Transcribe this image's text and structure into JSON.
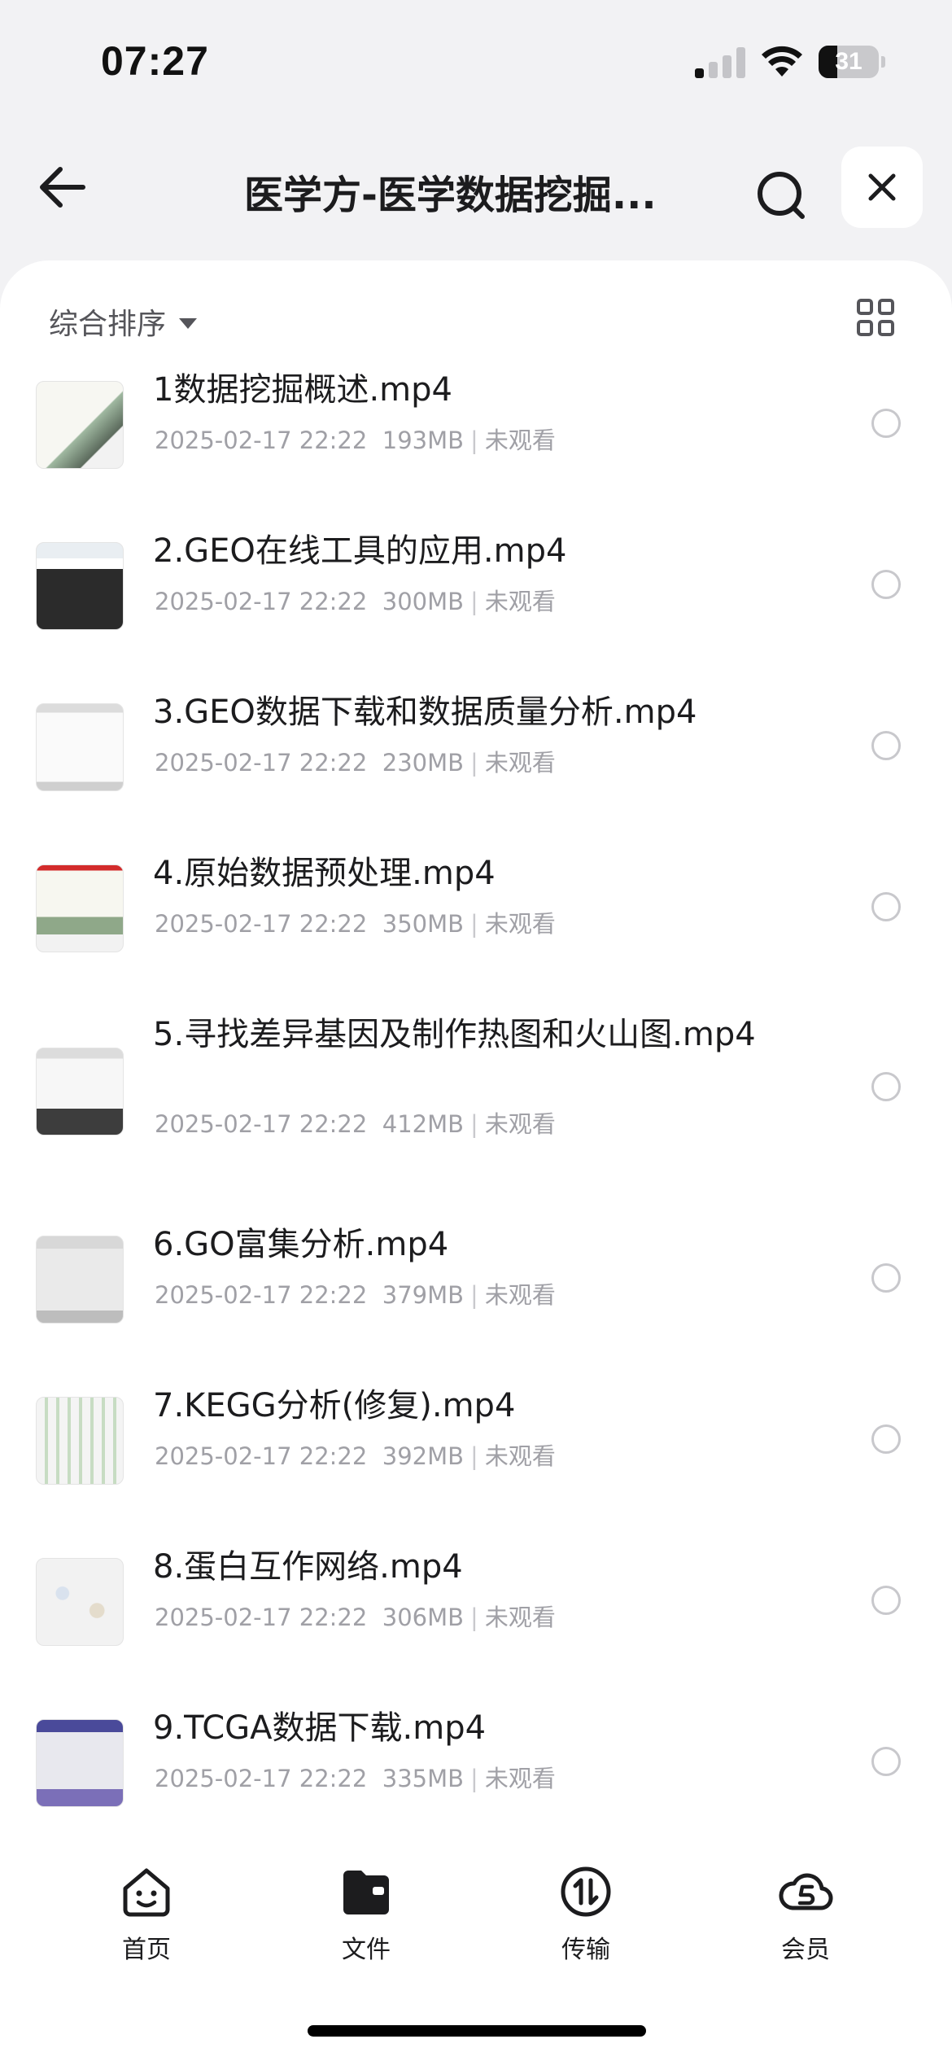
{
  "status_bar": {
    "time": "07:27",
    "battery": "31",
    "battery_level": 0.31
  },
  "header": {
    "title": "医学方-医学数据挖掘...",
    "back_icon": "arrow-left-icon",
    "search_icon": "search-icon",
    "close_icon": "close-icon"
  },
  "toolbar": {
    "sort_label": "综合排序",
    "grid_icon": "grid-view-icon"
  },
  "files": [
    {
      "name": "1数据挖掘概述.mp4",
      "date": "2025-02-17 22:22",
      "size": "193MB",
      "status": "未观看"
    },
    {
      "name": "2.GEO在线工具的应用.mp4",
      "date": "2025-02-17 22:22",
      "size": "300MB",
      "status": "未观看"
    },
    {
      "name": "3.GEO数据下载和数据质量分析.mp4",
      "date": "2025-02-17 22:22",
      "size": "230MB",
      "status": "未观看"
    },
    {
      "name": "4.原始数据预处理.mp4",
      "date": "2025-02-17 22:22",
      "size": "350MB",
      "status": "未观看"
    },
    {
      "name": "5.寻找差异基因及制作热图和火山图.mp4",
      "date": "2025-02-17 22:22",
      "size": "412MB",
      "status": "未观看"
    },
    {
      "name": "6.GO富集分析.mp4",
      "date": "2025-02-17 22:22",
      "size": "379MB",
      "status": "未观看"
    },
    {
      "name": "7.KEGG分析(修复).mp4",
      "date": "2025-02-17 22:22",
      "size": "392MB",
      "status": "未观看"
    },
    {
      "name": "8.蛋白互作网络.mp4",
      "date": "2025-02-17 22:22",
      "size": "306MB",
      "status": "未观看"
    },
    {
      "name": "9.TCGA数据下载.mp4",
      "date": "2025-02-17 22:22",
      "size": "335MB",
      "status": "未观看"
    }
  ],
  "tabs": [
    {
      "label": "首页",
      "icon": "home-face-icon"
    },
    {
      "label": "文件",
      "icon": "folder-icon"
    },
    {
      "label": "传输",
      "icon": "transfer-icon"
    },
    {
      "label": "会员",
      "icon": "vip-cloud-icon"
    }
  ]
}
